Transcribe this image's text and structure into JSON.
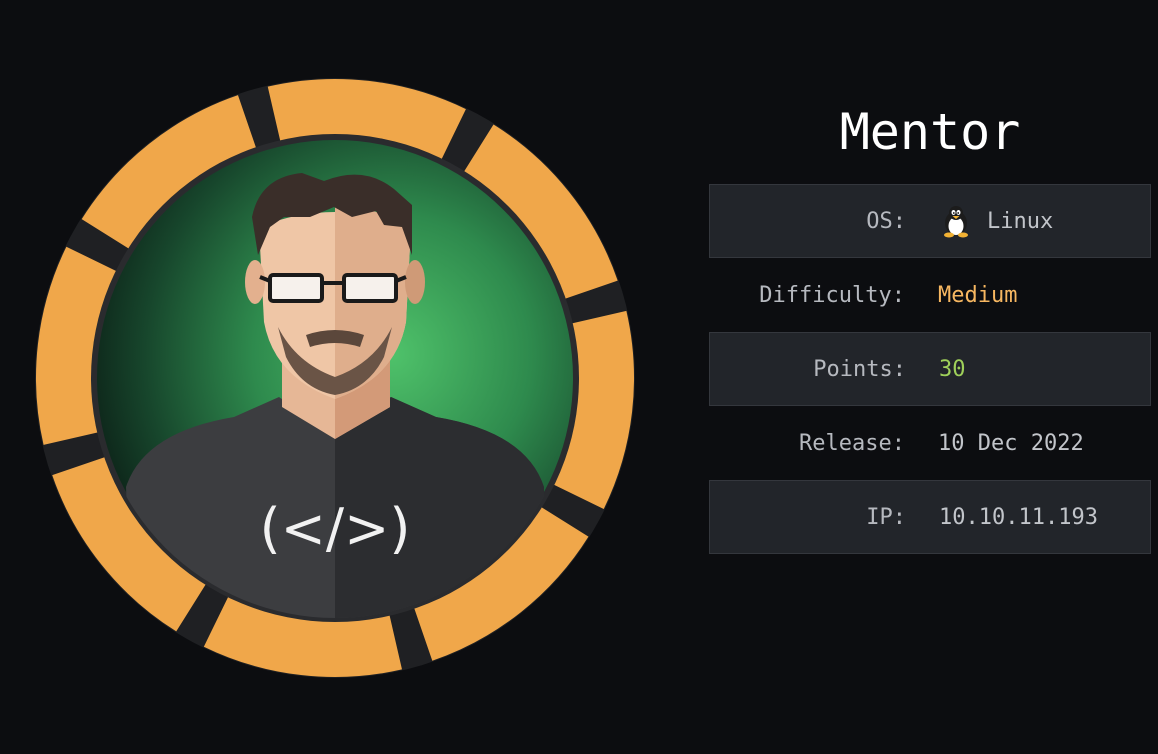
{
  "machine": {
    "name": "Mentor",
    "avatar_icon": "developer-avatar-icon",
    "ring_color": "#f0a74a"
  },
  "info": {
    "os": {
      "label": "OS:",
      "value": "Linux",
      "icon": "tux-penguin-icon"
    },
    "difficulty": {
      "label": "Difficulty:",
      "value": "Medium",
      "color": "#f7b761"
    },
    "points": {
      "label": "Points:",
      "value": "30",
      "color": "#9fd05a"
    },
    "release": {
      "label": "Release:",
      "value": "10 Dec 2022"
    },
    "ip": {
      "label": "IP:",
      "value": "10.10.11.193"
    }
  }
}
